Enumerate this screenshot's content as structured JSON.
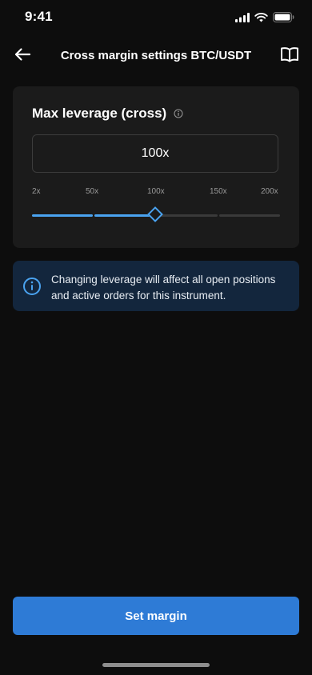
{
  "status_bar": {
    "time": "9:41",
    "icons": [
      "signal-icon",
      "wifi-icon",
      "battery-icon"
    ]
  },
  "nav": {
    "title": "Cross margin settings BTC/USDT",
    "back_icon": "arrow-left-icon",
    "right_icon": "book-open-icon"
  },
  "leverage_card": {
    "title": "Max leverage (cross)",
    "info_icon": "info-icon",
    "input_value": "100x",
    "slider": {
      "ticks": [
        "2x",
        "50x",
        "100x",
        "150x",
        "200x"
      ],
      "value": "100x",
      "active_color": "#4aa3f0",
      "inactive_color": "#3a3a3a"
    }
  },
  "notice": {
    "icon": "info-circle-icon",
    "text": "Changing leverage will affect all open positions and active orders for this instrument."
  },
  "footer": {
    "button_label": "Set margin",
    "button_color": "#2e7bd6"
  }
}
